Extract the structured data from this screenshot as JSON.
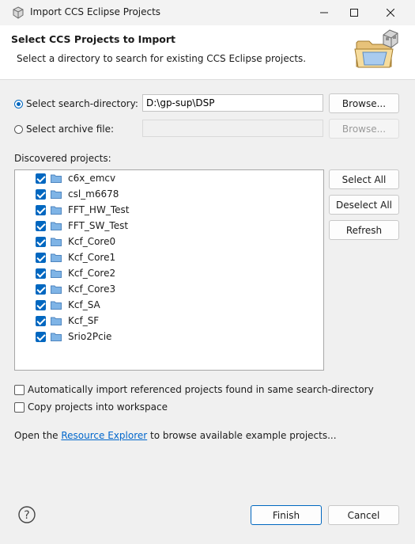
{
  "window": {
    "title": "Import CCS Eclipse Projects",
    "controls": [
      "minimize-icon",
      "maximize-icon",
      "close-icon"
    ]
  },
  "header": {
    "title": "Select CCS Projects to Import",
    "description": "Select a directory to search for existing CCS Eclipse projects.",
    "icon": "import-folder-icon"
  },
  "source": {
    "search_dir_label": "Select search-directory:",
    "search_dir_value": "D:\\gp-sup\\DSP",
    "search_dir_selected": true,
    "archive_label": "Select archive file:",
    "archive_value": "",
    "browse_label": "Browse..."
  },
  "projects": {
    "label": "Discovered projects:",
    "items": [
      {
        "name": "c6x_emcv",
        "checked": true
      },
      {
        "name": "csl_m6678",
        "checked": true
      },
      {
        "name": "FFT_HW_Test",
        "checked": true
      },
      {
        "name": "FFT_SW_Test",
        "checked": true
      },
      {
        "name": "Kcf_Core0",
        "checked": true
      },
      {
        "name": "Kcf_Core1",
        "checked": true
      },
      {
        "name": "Kcf_Core2",
        "checked": true
      },
      {
        "name": "Kcf_Core3",
        "checked": true
      },
      {
        "name": "Kcf_SA",
        "checked": true
      },
      {
        "name": "Kcf_SF",
        "checked": true
      },
      {
        "name": "Srio2Pcie",
        "checked": true
      }
    ],
    "select_all_label": "Select All",
    "deselect_all_label": "Deselect All",
    "refresh_label": "Refresh"
  },
  "options": {
    "auto_import_label": "Automatically import referenced projects found in same search-directory",
    "auto_import_checked": false,
    "copy_label": "Copy projects into workspace",
    "copy_checked": false
  },
  "explorer": {
    "prefix": "Open the ",
    "link": "Resource Explorer",
    "suffix": " to browse available example projects..."
  },
  "footer": {
    "finish_label": "Finish",
    "cancel_label": "Cancel",
    "help_icon": "help-icon"
  },
  "colors": {
    "accent": "#0067c0",
    "link": "#0066cc",
    "folder": "#7fb4e6"
  }
}
